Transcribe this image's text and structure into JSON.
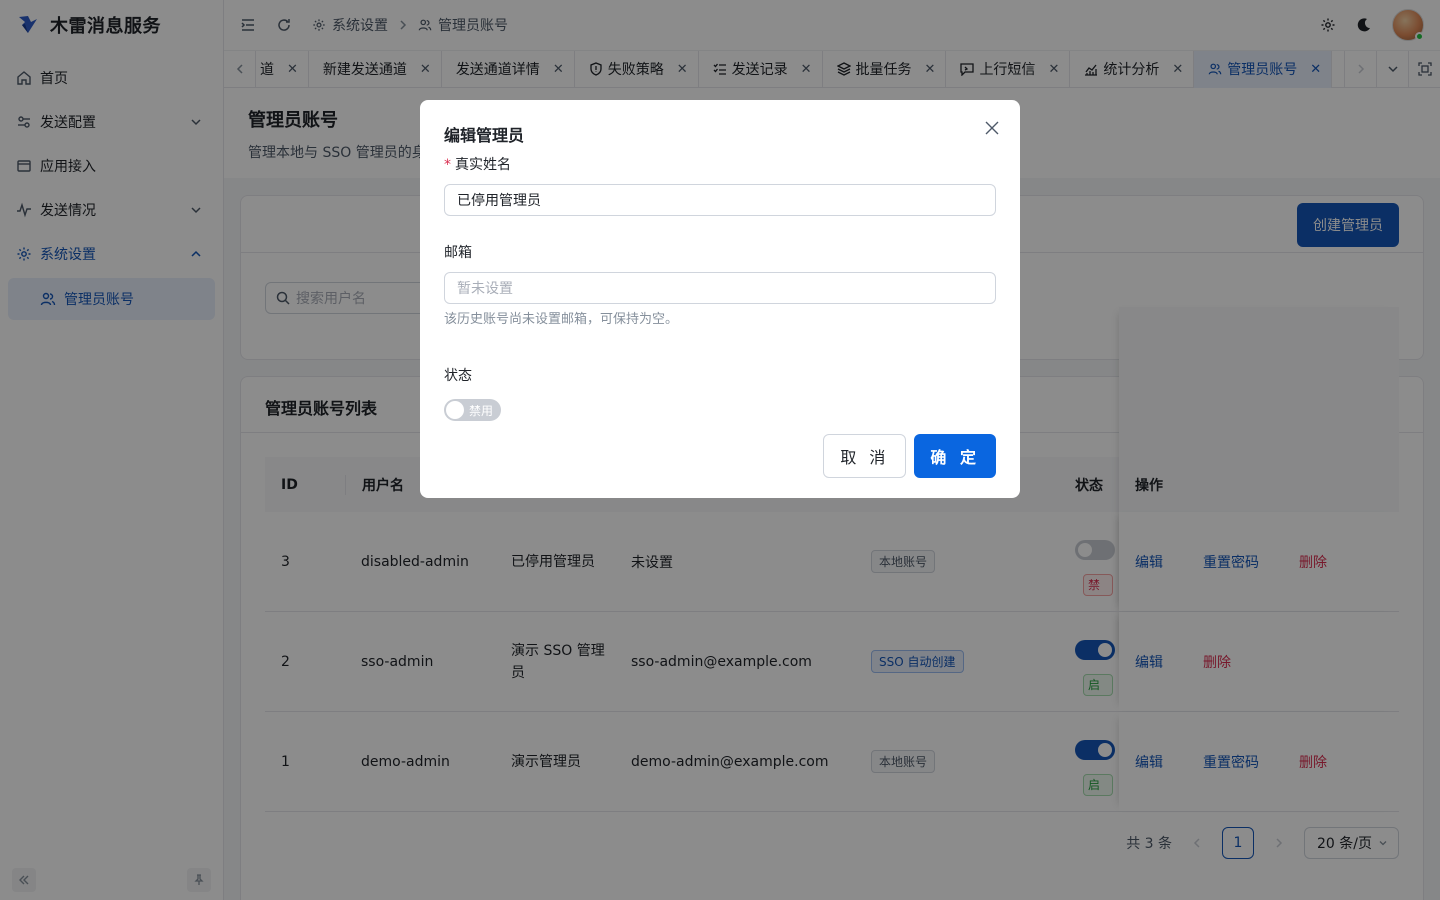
{
  "app": {
    "name": "木雷消息服务"
  },
  "sidebar": {
    "items": [
      {
        "label": "首页"
      },
      {
        "label": "发送配置"
      },
      {
        "label": "应用接入"
      },
      {
        "label": "发送情况"
      },
      {
        "label": "系统设置"
      }
    ],
    "sub_items": [
      {
        "label": "管理员账号"
      }
    ]
  },
  "header": {
    "breadcrumb": [
      "系统设置",
      "管理员账号"
    ]
  },
  "tabs": [
    {
      "label": "道",
      "icon": ""
    },
    {
      "label": "新建发送通道",
      "icon": ""
    },
    {
      "label": "发送通道详情",
      "icon": ""
    },
    {
      "label": "失败策略",
      "icon": "shield-icon"
    },
    {
      "label": "发送记录",
      "icon": "list-check-icon"
    },
    {
      "label": "批量任务",
      "icon": "layers-icon"
    },
    {
      "label": "上行短信",
      "icon": "message-icon"
    },
    {
      "label": "统计分析",
      "icon": "chart-icon"
    },
    {
      "label": "管理员账号",
      "icon": "users-icon",
      "active": true
    }
  ],
  "page": {
    "title": "管理员账号",
    "subtitle": "管理本地与 SSO 管理员的身",
    "create_button": "创建管理员",
    "search_placeholder": "搜索用户名",
    "list_title": "管理员账号列表"
  },
  "table": {
    "columns": {
      "id": "ID",
      "username": "用户名",
      "status": "状态",
      "ops": "操作"
    },
    "rows": [
      {
        "id": "3",
        "username": "disabled-admin",
        "name": "已停用管理员",
        "email": "未设置",
        "source": "本地账号",
        "source_type": "local",
        "status_on": false,
        "status_label": "禁",
        "ops": [
          "编辑",
          "重置密码",
          "删除"
        ]
      },
      {
        "id": "2",
        "username": "sso-admin",
        "name": "演示 SSO 管理员",
        "email": "sso-admin@example.com",
        "source": "SSO 自动创建",
        "source_type": "sso",
        "status_on": true,
        "status_label": "启",
        "ops": [
          "编辑",
          "删除"
        ]
      },
      {
        "id": "1",
        "username": "demo-admin",
        "name": "演示管理员",
        "email": "demo-admin@example.com",
        "source": "本地账号",
        "source_type": "local",
        "status_on": true,
        "status_label": "启",
        "ops": [
          "编辑",
          "重置密码",
          "删除"
        ]
      }
    ]
  },
  "pagination": {
    "total": "共 3 条",
    "current": "1",
    "page_size": "20 条/页"
  },
  "modal": {
    "title": "编辑管理员",
    "name_label": "真实姓名",
    "name_value": "已停用管理员",
    "email_label": "邮箱",
    "email_placeholder": "暂未设置",
    "email_help": "该历史账号尚未设置邮箱，可保持为空。",
    "status_label": "状态",
    "status_text": "禁用",
    "cancel": "取 消",
    "ok": "确 定"
  }
}
